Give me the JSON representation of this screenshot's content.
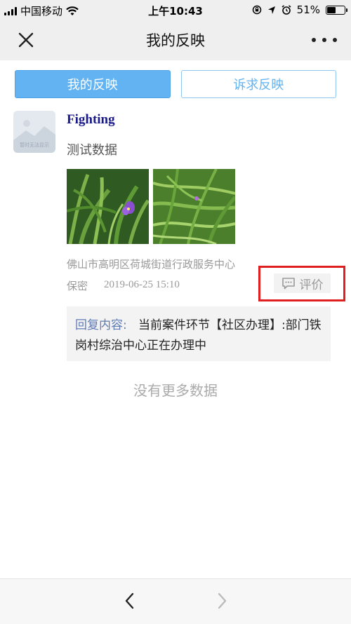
{
  "status_bar": {
    "carrier": "中国移动",
    "time": "上午10:43",
    "battery_percent": "51%",
    "battery_level": 0.51
  },
  "nav": {
    "title": "我的反映",
    "close_icon": "close-icon",
    "more_icon": "more-icon"
  },
  "tabs": [
    {
      "label": "我的反映",
      "active": true
    },
    {
      "label": "诉求反映",
      "active": false
    }
  ],
  "post": {
    "avatar_caption": "暂时无法显示",
    "user_name": "Fighting",
    "content": "测试数据",
    "location": "佛山市高明区荷城街道行政服务中心",
    "privacy": "保密",
    "date": "2019-06-25 15:10",
    "rate_label": "评价",
    "reply_label": "回复内容:",
    "reply_text": "当前案件环节【社区办理】:部门铁岗村综治中心正在办理中"
  },
  "footer": {
    "no_more": "没有更多数据"
  },
  "colors": {
    "accent": "#63b3f2",
    "highlight": "#e02020",
    "name": "#1a1a8c",
    "reply_label": "#5f7bb5"
  }
}
